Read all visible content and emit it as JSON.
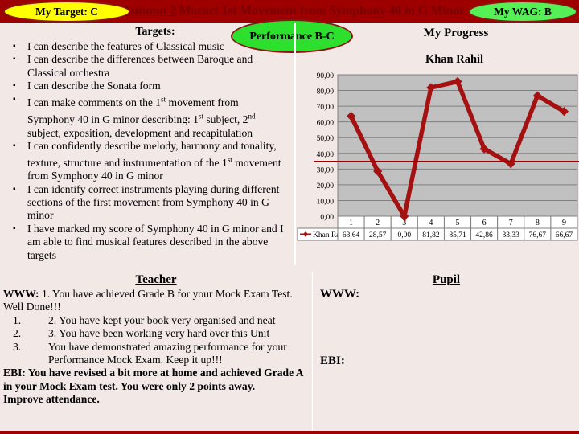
{
  "header": {
    "title_underlined": "Autumn 2",
    "title_rest": " Mozart  1st Movement from Symphony 40 in G Minor",
    "title_full": "Autumn 2  Mozart  1st Movement from Symphony 40 in G Minor",
    "badge_target": "My Target: C",
    "badge_wag": "My WAG: B",
    "badge_performance": "Performance B-C",
    "colors": {
      "band": "#9e0000",
      "badge_target_fill": "#ffff00",
      "badge_wag_fill": "#55f055",
      "badge_performance_fill": "#2ee02e",
      "badge_stroke": "#8c1616",
      "page_background": "#f2e8e6"
    }
  },
  "targets": {
    "heading": "Targets:",
    "items": [
      "I can describe the features of Classical music",
      "I can describe the differences between Baroque and Classical orchestra",
      "I can describe the Sonata form",
      "I can make comments on the 1st movement from Symphony 40 in G minor describing: 1st subject, 2nd subject, exposition, development and recapitulation",
      "I can confidently describe melody, harmony and tonality, texture, structure and instrumentation of the 1st movement from Symphony 40 in G minor",
      "I can identify correct instruments playing during different sections of the first movement from Symphony 40 in G minor",
      "I have marked my score of Symphony 40 in G minor and I am able to find musical features described in the above targets"
    ]
  },
  "progress": {
    "heading": "My Progress"
  },
  "chart_data": {
    "type": "line",
    "title": "Khan Rahil",
    "series_name": "Khan Rahil",
    "categories": [
      "1",
      "2",
      "3",
      "4",
      "5",
      "6",
      "7",
      "8",
      "9"
    ],
    "values": [
      63.64,
      28.57,
      0.0,
      81.82,
      85.71,
      42.86,
      33.33,
      76.67,
      66.67
    ],
    "value_labels": [
      "63,64",
      "28,57",
      "0,00",
      "81,82",
      "85,71",
      "42,86",
      "33,33",
      "76,67",
      "66,67"
    ],
    "ytick_labels": [
      "90,00",
      "80,00",
      "70,00",
      "60,00",
      "50,00",
      "40,00",
      "30,00",
      "20,00",
      "10,00",
      "0,00"
    ],
    "ylim": [
      0,
      90
    ],
    "xlabel": "",
    "ylabel": "",
    "grid": true,
    "legend_position": "bottom-left",
    "plot_background": "#c0c0c0",
    "line_color": "#a51111",
    "marker": "diamond",
    "data_table_visible": true
  },
  "teacher": {
    "title": "Teacher",
    "www_label": "WWW:",
    "www_intro": "1. You have achieved  Grade B for your Mock Exam Test. Well Done!!!",
    "www_items": [
      "2. You have kept your book very organised and neat",
      "3. You have been working very hard over this Unit",
      "You have demonstrated amazing performance for your Performance Mock Exam. Keep it up!!!"
    ],
    "ebi_label": "EBI:",
    "ebi_text": "You have revised a bit more at home and achieved Grade A in your Mock Exam test. You were only 2 points away.",
    "extra_text": "Improve attendance."
  },
  "pupil": {
    "title": "Pupil",
    "www_label": "WWW:",
    "ebi_label": "EBI:"
  }
}
